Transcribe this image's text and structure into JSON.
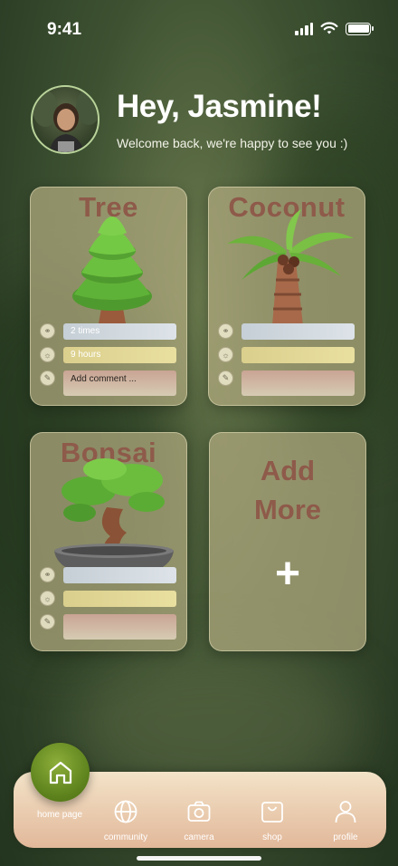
{
  "status": {
    "time": "9:41"
  },
  "header": {
    "greeting": "Hey, Jasmine!",
    "welcome": "Welcome back, we're happy to see you :)"
  },
  "cards": [
    {
      "title": "Tree",
      "water": "2 times",
      "sun": "9 hours",
      "comment": "Add comment ..."
    },
    {
      "title": "Coconut",
      "water": "",
      "sun": "",
      "comment": ""
    },
    {
      "title": "Bonsai",
      "water": "",
      "sun": "",
      "comment": ""
    }
  ],
  "add_card": {
    "line1": "Add",
    "line2": "More",
    "plus": "+"
  },
  "nav": {
    "home": "home page",
    "community": "community",
    "camera": "camera",
    "shop": "shop",
    "profile": "profile"
  },
  "colors": {
    "card_title": "#8e5a4a",
    "home_button": "#5a7f1b",
    "nav_bar": "#e2b89a"
  }
}
